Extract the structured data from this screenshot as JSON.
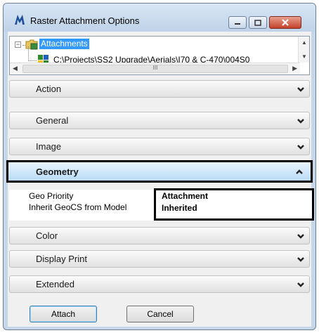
{
  "window": {
    "title": "Raster Attachment Options"
  },
  "tree": {
    "expander": "−",
    "root_label": "Attachments",
    "child_path": "C:\\Projects\\SS2 Upgrade\\Aerials\\I70 & C-470\\004S0",
    "hscroll_grip": "III"
  },
  "sections": {
    "action": "Action",
    "general": "General",
    "image": "Image",
    "geometry": "Geometry",
    "color": "Color",
    "display_print": "Display Print",
    "extended": "Extended"
  },
  "geometry_props": [
    {
      "name": "Geo Priority",
      "value": "Attachment"
    },
    {
      "name": "Inherit GeoCS from Model",
      "value": "Inherited"
    }
  ],
  "buttons": {
    "attach": "Attach",
    "cancel": "Cancel"
  },
  "colors": {
    "selection": "#3399ff",
    "open_section": "#b9dcf6",
    "close_button": "#c4412a"
  }
}
